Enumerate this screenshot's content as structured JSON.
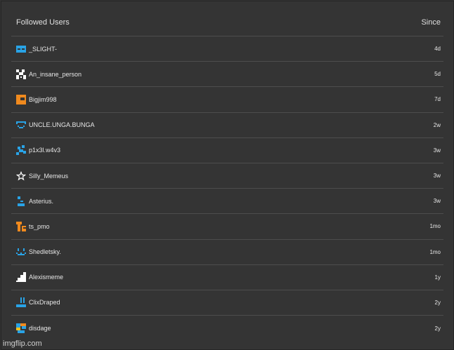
{
  "header": {
    "title": "Followed Users",
    "since": "Since"
  },
  "users": [
    {
      "name": "_SLIGHT-",
      "since": "4d",
      "icon": "blue-block-icon",
      "color": "#29a3e6"
    },
    {
      "name": "An_insane_person",
      "since": "5d",
      "icon": "white-checker-icon",
      "color": "#ffffff"
    },
    {
      "name": "Bigjim998",
      "since": "7d",
      "icon": "orange-block-icon",
      "color": "#f08a1e"
    },
    {
      "name": "UNCLE.UNGA.BUNGA",
      "since": "2w",
      "icon": "blue-face-icon",
      "color": "#29a3e6"
    },
    {
      "name": "p1x3l.w4v3",
      "since": "3w",
      "icon": "blue-pixel-icon",
      "color": "#29a3e6"
    },
    {
      "name": "Silly_Memeus",
      "since": "3w",
      "icon": "star-icon",
      "color": "#ffffff"
    },
    {
      "name": "Asterius.",
      "since": "3w",
      "icon": "blue-dots-icon",
      "color": "#29a3e6"
    },
    {
      "name": "ts_pmo",
      "since": "1mo",
      "icon": "orange-ts-icon",
      "color": "#f08a1e"
    },
    {
      "name": "Shedletsky.",
      "since": "1mo",
      "icon": "blue-smile-icon",
      "color": "#29a3e6"
    },
    {
      "name": "Alexismeme",
      "since": "1y",
      "icon": "white-stairs-icon",
      "color": "#ffffff"
    },
    {
      "name": "ClixDraped",
      "since": "2y",
      "icon": "blue-underscore-icon",
      "color": "#29a3e6"
    },
    {
      "name": "disdage",
      "since": "2y",
      "icon": "mixed-pixel-icon",
      "color": "#29a3e6"
    }
  ],
  "watermark": "imgflip.com"
}
